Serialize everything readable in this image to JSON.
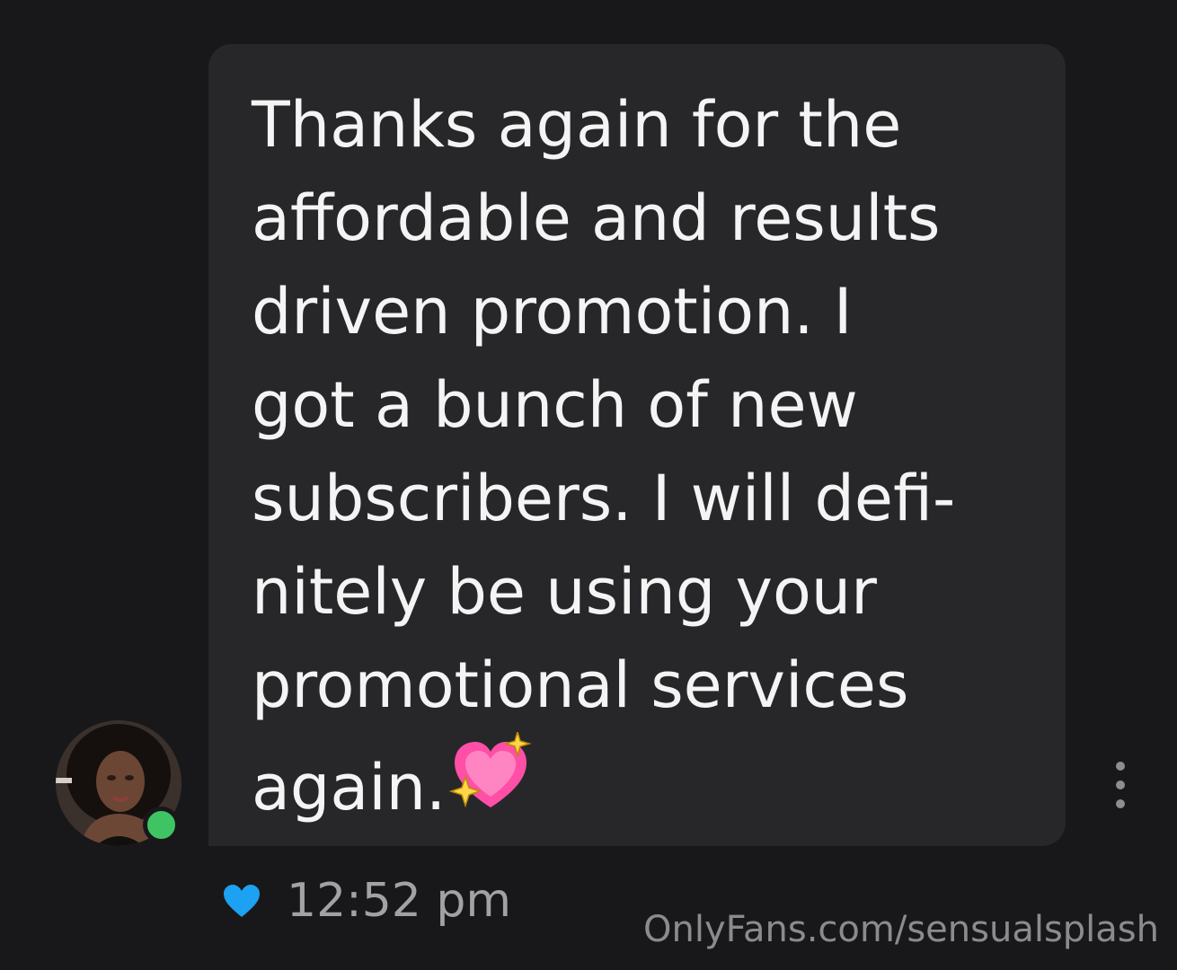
{
  "message": {
    "lines": [
      "Thanks again for the",
      "affordable and results",
      "driven promotion. I",
      "got a bunch of new",
      "subscribers. I will defi-",
      "nitely be using your",
      "promotional services",
      "again."
    ],
    "emoji": "sparkling-heart-icon",
    "timestamp": "12:52 pm"
  },
  "sender": {
    "online": true,
    "status_color": "#3fc464"
  },
  "like_icon": "heart-icon",
  "like_color": "#1da1f2",
  "watermark": "OnlyFans.com/sensualsplash"
}
